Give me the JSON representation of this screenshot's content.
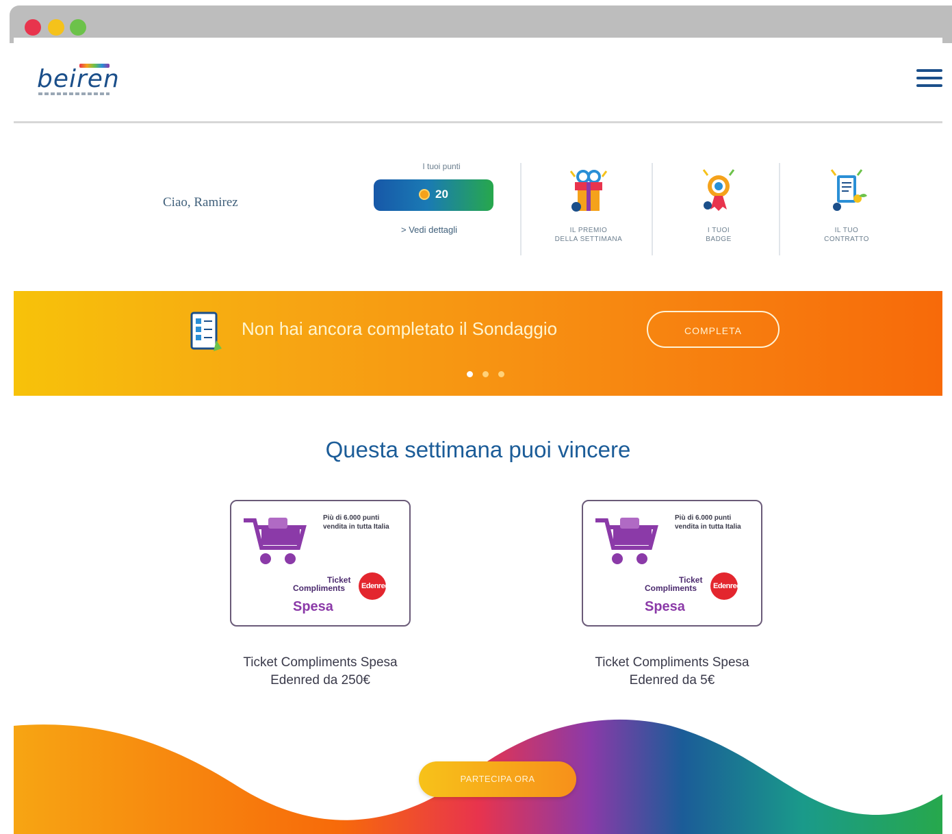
{
  "window": {
    "controls": [
      "close",
      "minimize",
      "maximize"
    ]
  },
  "header": {
    "logo": "beiren",
    "menu_icon": "hamburger-menu-icon"
  },
  "userbar": {
    "greeting": "Ciao, Ramirez",
    "points_label": "I tuoi punti",
    "points_value": "20",
    "details_link": "> Vedi dettagli",
    "nav_items": [
      {
        "line1": "IL PREMIO",
        "line2": "DELLA SETTIMANA",
        "icon": "gift-icon"
      },
      {
        "line1": "I TUOI",
        "line2": "BADGE",
        "icon": "badge-icon"
      },
      {
        "line1": "IL TUO",
        "line2": "CONTRATTO",
        "icon": "contract-icon"
      }
    ]
  },
  "banner": {
    "icon": "survey-icon",
    "text": "Non hai ancora completato il Sondaggio",
    "button": "COMPLETA",
    "dots": 3,
    "active_dot": 0
  },
  "prizes": {
    "title": "Questa settimana puoi vincere",
    "items": [
      {
        "fine_print": "Più di 6.000 punti vendita in tutta Italia",
        "ticket": "Ticket",
        "compliments": "Compliments",
        "brand": "Edenred",
        "product": "Spesa",
        "title_line1": "Ticket Compliments Spesa",
        "title_line2": "Edenred da 250€"
      },
      {
        "fine_print": "Più di 6.000 punti vendita in tutta Italia",
        "ticket": "Ticket",
        "compliments": "Compliments",
        "brand": "Edenred",
        "product": "Spesa",
        "title_line1": "Ticket Compliments Spesa",
        "title_line2": "Edenred da 5€"
      }
    ]
  },
  "cta": {
    "label": "PARTECIPA ORA"
  },
  "colors": {
    "brand_blue": "#1b4f8a",
    "title_blue": "#1b5c98",
    "banner_orange": "#f78811",
    "banner_yellow": "#f7c20a",
    "points_green": "#27a84c"
  }
}
